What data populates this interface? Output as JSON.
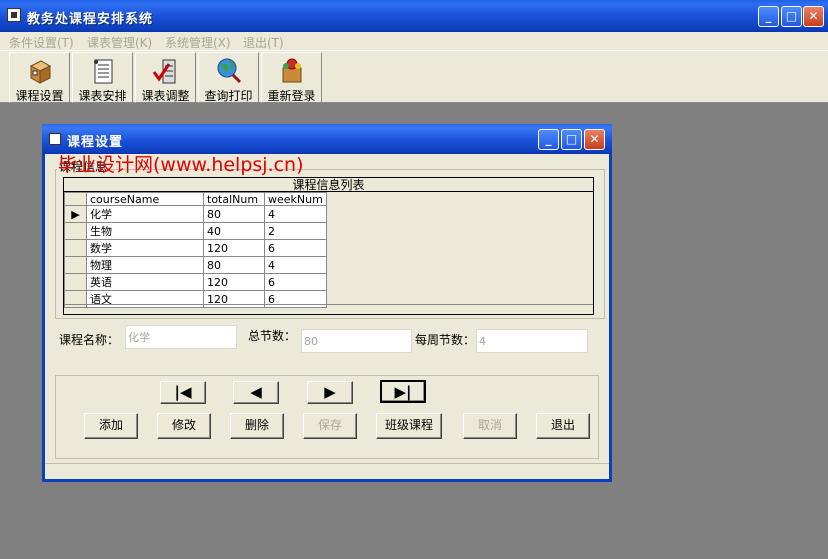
{
  "window": {
    "title": "教务处课程安排系统",
    "min": "_",
    "max": "□",
    "close": "✕"
  },
  "menu": [
    "条件设置(T)",
    "课表管理(K)",
    "系统管理(X)",
    "退出(T)"
  ],
  "toolbar": [
    "课程设置",
    "课表安排",
    "课表调整",
    "查询打印",
    "重新登录"
  ],
  "child": {
    "title": "课程设置",
    "watermark": "毕业设计网(www.helpsj.cn)",
    "group_label": "课程信息",
    "grid": {
      "caption": "课程信息列表",
      "columns": [
        "courseName",
        "totalNum",
        "weekNum"
      ],
      "rows": [
        [
          "化学",
          "80",
          "4"
        ],
        [
          "生物",
          "40",
          "2"
        ],
        [
          "数学",
          "120",
          "6"
        ],
        [
          "物理",
          "80",
          "4"
        ],
        [
          "英语",
          "120",
          "6"
        ],
        [
          "语文",
          "120",
          "6"
        ]
      ]
    },
    "fields": {
      "course_name_label": "课程名称：",
      "course_name_value": "化学",
      "total_label": "总节数：",
      "total_value": "80",
      "weekly_label": "每周节数：",
      "weekly_value": "4"
    },
    "nav": {
      "first": "|◀",
      "prev": "◀",
      "next": "▶",
      "last": "▶|"
    },
    "buttons": {
      "add": "添加",
      "edit": "修改",
      "delete": "删除",
      "save": "保存",
      "class_course": "班级课程",
      "cancel": "取消",
      "exit": "退出"
    }
  }
}
